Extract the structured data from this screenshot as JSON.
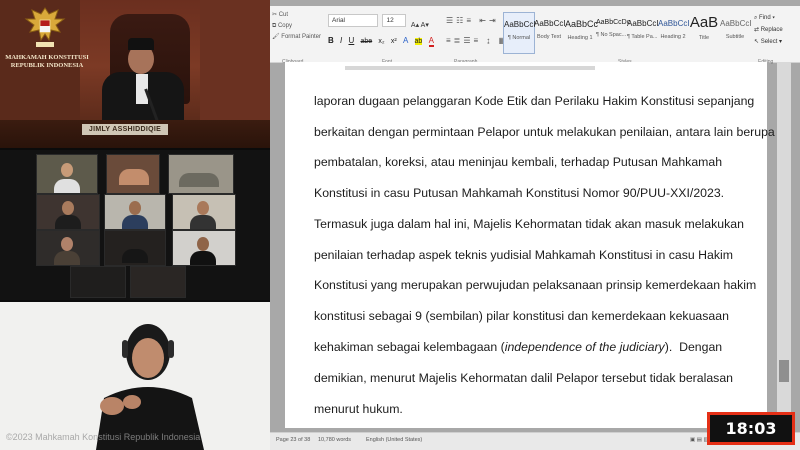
{
  "broadcast": {
    "court_name": "MAHKAMAH KONSTITUSI",
    "court_country": "REPUBLIK INDONESIA",
    "nameplate": "JIMLY ASSHIDDIQIE",
    "watermark": "©2023 Mahkamah Konstitusi Republik Indonesia",
    "clock": "18:03",
    "accent_color": "#e53017"
  },
  "word": {
    "clipboard": {
      "cut": "Cut",
      "copy": "Copy",
      "format_painter": "Format Painter"
    },
    "font": {
      "name": "Arial",
      "size": "12"
    },
    "format_buttons": [
      "B",
      "I",
      "U",
      "abe",
      "x₂",
      "x²",
      "A",
      "ab",
      "A"
    ],
    "styles": [
      {
        "preview": "AaBbCcI",
        "name": "¶ Normal"
      },
      {
        "preview": "AaBbCcI",
        "name": "Body Text"
      },
      {
        "preview": "AaBbCc",
        "name": "Heading 1"
      },
      {
        "preview": "AaBbCcDc",
        "name": "¶ No Spac..."
      },
      {
        "preview": "AaBbCcI",
        "name": "¶ Table Pa..."
      },
      {
        "preview": "AaBbCcI",
        "name": "Heading 2"
      },
      {
        "preview": "AaB",
        "name": "Title"
      },
      {
        "preview": "AaBbCcI",
        "name": "Subtitle"
      }
    ],
    "editing": {
      "find": "Find ▾",
      "replace": "Replace",
      "select": "Select ▾"
    },
    "group_labels": {
      "clipboard": "Clipboard",
      "font": "Font",
      "paragraph": "Paragraph",
      "styles": "Styles",
      "editing": "Editing"
    },
    "document_lines": [
      "laporan dugaan pelanggaran Kode Etik dan Perilaku Hakim Konstitusi sepanjang",
      "berkaitan dengan permintaan Pelapor untuk melakukan penilaian, antara lain berupa",
      "pembatalan, koreksi, atau meninjau kembali, terhadap Putusan Mahkamah",
      "Konstitusi in casu Putusan Mahkamah Konstitusi Nomor 90/PUU-XXI/2023.",
      "Termasuk juga dalam hal ini, Majelis Kehormatan tidak akan masuk melakukan",
      "penilaian terhadap aspek teknis yudisial Mahkamah Konstitusi in casu Hakim",
      "Konstitusi yang merupakan  perwujudan pelaksanaan prinsip kemerdekaan hakim",
      "konstitusi sebagai 9 (sembilan) pilar konstitusi dan kemerdekaan kekuasaan",
      "kehakiman sebagai kelembagaan (independence of the judiciary).  Dengan",
      "demikian, menurut Majelis Kehormatan dalil Pelapor tersebut tidak beralasan",
      "menurut hukum."
    ],
    "status": {
      "page": "Page 23 of 38",
      "words": "10,780 words",
      "language": "English (United States)"
    }
  }
}
